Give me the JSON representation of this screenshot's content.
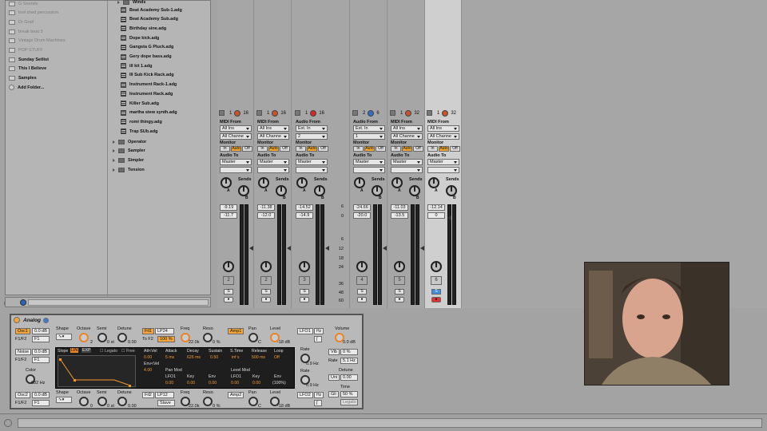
{
  "browser": {
    "places": [
      {
        "label": "G Sounds",
        "dim": true
      },
      {
        "label": "tool shed percussion",
        "dim": true
      },
      {
        "label": "Dr Grail",
        "dim": true
      },
      {
        "label": "break beat 3",
        "dim": true
      },
      {
        "label": "Vintage Drum Machines",
        "dim": true
      },
      {
        "label": "POP STUFF",
        "dim": true
      },
      {
        "label": "Sunday Setlist",
        "dim": false
      },
      {
        "label": "This I Believe",
        "dim": false
      },
      {
        "label": "Samples",
        "dim": false
      },
      {
        "label": "Add Folder...",
        "dim": false
      }
    ],
    "files_header": "Winds",
    "files": [
      "Beat Academy Sub-1.adg",
      "Beat Academy Sub.adg",
      "Birthday sine.adg",
      "Dope kick.adg",
      "Gangsta G Pluck.adg",
      "Gery dope bass.adg",
      "ill kit 1.adg",
      "Ill Sub Kick Rack.adg",
      "Instrument Rack-1.adg",
      "Instrument Rack.adg",
      "Killer Sub.adg",
      "martha stew synth.adg",
      "romi thingy.adg",
      "Trap SUb.adg"
    ],
    "folders": [
      "Operator",
      "Sampler",
      "Simpler",
      "Tension"
    ]
  },
  "tracks": [
    {
      "num_a": "1",
      "num_b": "16",
      "from_label": "MIDI From",
      "from": "All Ins",
      "chan": "All Channe",
      "monitor": "Auto",
      "to": "Master",
      "vol": "-9.19",
      "peak": "-11.7",
      "track_num": "2",
      "rec": "orange"
    },
    {
      "num_a": "1",
      "num_b": "16",
      "from_label": "MIDI From",
      "from": "All Ins",
      "chan": "All Channe",
      "monitor": "Auto",
      "to": "Master",
      "vol": "-11.38",
      "peak": "-12.0",
      "track_num": "2",
      "rec": "orange"
    },
    {
      "num_a": "1",
      "num_b": "16",
      "from_label": "Audio From",
      "from": "Ext. In",
      "chan": "2",
      "monitor": "Auto",
      "to": "Master",
      "vol": "-14.52",
      "peak": "-14.9",
      "track_num": "3",
      "rec": "red"
    },
    {
      "num_a": "2",
      "num_b": "6",
      "from_label": "Audio From",
      "from": "Ext. In",
      "chan": "1",
      "monitor": "Auto",
      "to": "Master",
      "vol": "-24.66",
      "peak": "-20.0",
      "track_num": "4",
      "rec": "blue"
    },
    {
      "num_a": "1",
      "num_b": "32",
      "from_label": "MIDI From",
      "from": "All Ins",
      "chan": "All Channe",
      "monitor": "Auto",
      "to": "Master",
      "vol": "-11.03",
      "peak": "-13.5",
      "track_num": "5",
      "rec": "orange"
    },
    {
      "num_a": "1",
      "num_b": "32",
      "from_label": "MIDI From",
      "from": "All Ins",
      "chan": "All Channe",
      "monitor": "Auto",
      "to": "Master",
      "vol": "-12.14",
      "peak": "0",
      "track_num": "6",
      "rec": "orange"
    }
  ],
  "mixer_labels": {
    "monitor": "Monitor",
    "in": "In",
    "auto": "Auto",
    "off": "Off",
    "audio_to": "Audio To",
    "sends": "Sends",
    "a": "A",
    "b": "B",
    "s": "S"
  },
  "scale": [
    "6",
    "0",
    "6",
    "12",
    "18",
    "24",
    "36",
    "48",
    "60"
  ],
  "device": {
    "title": "Analog",
    "osc1": "Osc1",
    "osc1_gain": "0.0 dB",
    "f1f2": "F1/F2",
    "f1": "F1",
    "shape": "Shape",
    "octave": "Octave",
    "octave_val": "2",
    "semi": "Semi",
    "semi_val": "0",
    "detune": "Detune",
    "detune_val": "0.00",
    "fil1": "Fil1",
    "filter_type": "LP24",
    "to_f2": "To F2",
    "to_f2_val": "100 %",
    "freq": "Freq",
    "freq_val": "22.0k",
    "reso": "Reso",
    "reso_val": "0 %",
    "amp1": "Amp1",
    "pan": "Pan",
    "pan_val": "C",
    "level": "Level",
    "level_val": "-18 dB",
    "lfo1": "LFO1",
    "lfo2": "LFO2",
    "hz": "Hz",
    "rate": "Rate",
    "rate_val": "0.9 Hz",
    "volume": "Volume",
    "volume_val": "0.0 dB",
    "vib": "Vib",
    "vib_val": "0 %",
    "rate2": "Rate",
    "rate2_val": "5.1 Hz",
    "detune2": "Detune",
    "uni": "Uni",
    "uni_val": "0.00",
    "time": "Time",
    "gli": "Gli",
    "gli_val": "50 %",
    "legato2": "Legato",
    "noise": "Noise",
    "noise_gain": "0.0 dB",
    "color": "Color",
    "color_val": "682 Hz",
    "osc2": "Osc2",
    "osc2_gain": "0.0 dB",
    "f1f2b": "F1/F2",
    "f1b": "F1",
    "octave2_val": "0",
    "semi2_val": "0 st",
    "detune3_val": "0.00",
    "fil2": "Fil2",
    "filter2_type": "LP12",
    "slave": "Slave",
    "freq2_val": "22.0k",
    "reso2_val": "0 %",
    "amp2": "Amp2",
    "pan2_val": "C",
    "level2_val": "-18 dB",
    "semi_st": "0 st"
  },
  "env": {
    "slope": "Slope",
    "lin": "LIN",
    "exp": "EXP",
    "legato": "Legato",
    "free": "Free",
    "attvel": "Att<Vel",
    "attvel_val": "0.00",
    "attack": "Attack",
    "attack_val": "5 ms",
    "decay": "Decay",
    "decay_val": "626 ms",
    "sustain": "Sustain",
    "sustain_val": "0.50",
    "stime": "S.Time",
    "stime_val": "inf s",
    "release": "Release",
    "release_val": "500 ms",
    "loop": "Loop",
    "loop_val": "Off",
    "envvel": "Env<Vel",
    "envvel_val": "4.00",
    "pan_mod": "Pan Mod",
    "level_mod": "Level Mod",
    "lfo1": "LFO1",
    "key": "Key",
    "env": "Env",
    "pm_lfo": "0.00",
    "pm_key": "0.00",
    "pm_env": "0.00",
    "lm_lfo": "0.00",
    "lm_key": "0.00",
    "lm_env": "(100%)"
  }
}
